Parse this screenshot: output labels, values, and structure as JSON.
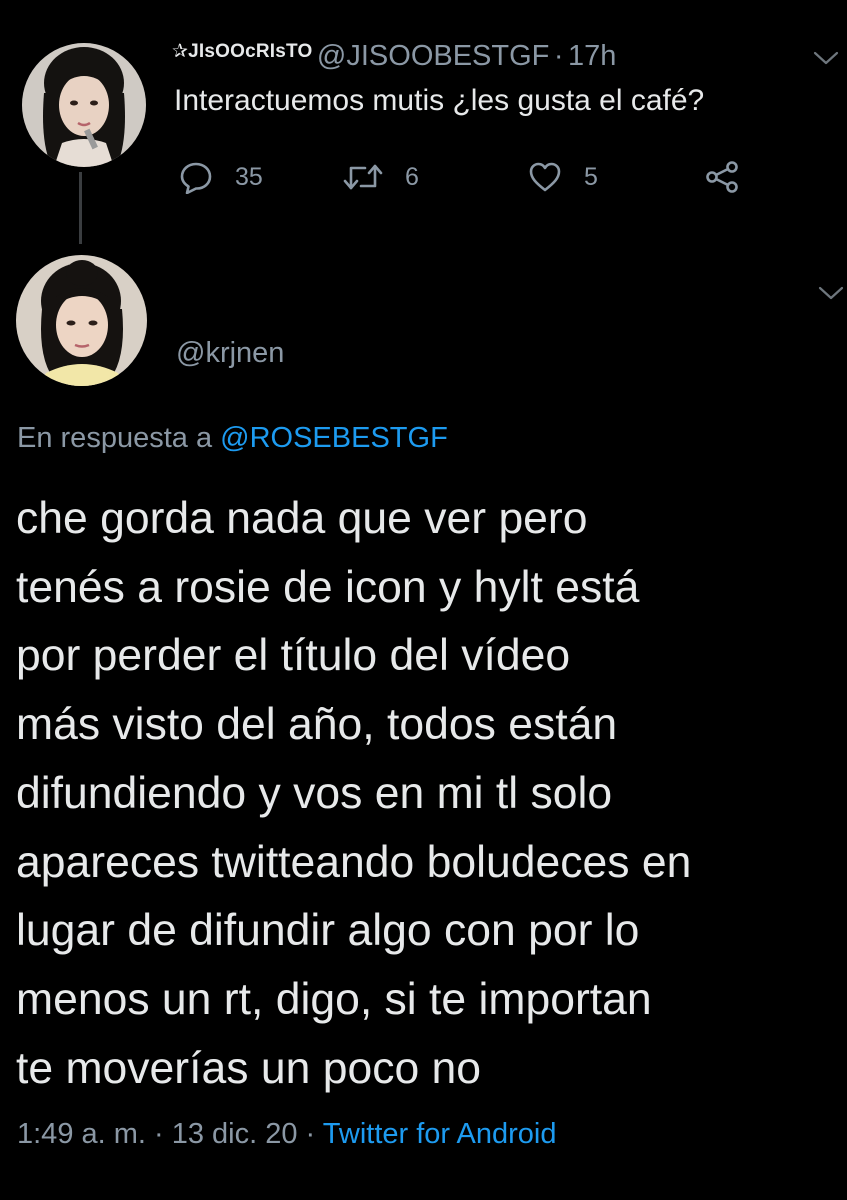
{
  "parent_tweet": {
    "display_name": "✰JIsOOcRIsTO",
    "handle": "@JISOOBESTGF",
    "separator": "·",
    "time": "17h",
    "text": "Interactuemos mutis ¿les gusta el café?",
    "actions": {
      "reply": {
        "icon": "reply-icon",
        "count": "35"
      },
      "retweet": {
        "icon": "retweet-icon",
        "count": "6"
      },
      "like": {
        "icon": "heart-icon",
        "count": "5"
      },
      "share": {
        "icon": "share-icon"
      }
    }
  },
  "reply_tweet": {
    "handle": "@krjnen",
    "reply_to_label": "En respuesta a",
    "reply_to_handle": "@ROSEBESTGF",
    "text_lines": [
      "che gorda nada que ver pero",
      "tenés a rosie de icon y hylt está",
      "por perder el título del vídeo",
      "más visto del año, todos están",
      "difundiendo y vos en mi tl solo",
      "apareces twitteando boludeces en",
      "lugar de difundir algo con por lo",
      "menos un rt, digo, si te importan",
      "te moverías un poco no"
    ],
    "timestamp": "1:49 a. m. · 13 dic. 20",
    "meta_separator": "·",
    "source": "Twitter for Android"
  },
  "colors": {
    "background": "#000000",
    "text": "#e7e9ea",
    "muted": "#8b98a5",
    "link": "#1d9bf0"
  }
}
